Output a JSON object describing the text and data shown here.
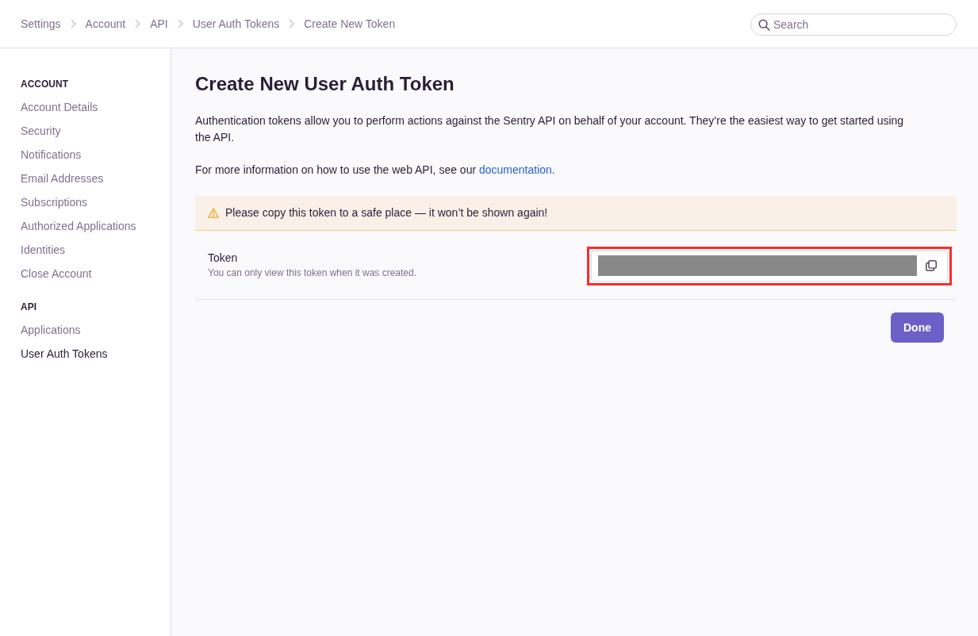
{
  "breadcrumbs": [
    {
      "label": "Settings"
    },
    {
      "label": "Account"
    },
    {
      "label": "API"
    },
    {
      "label": "User Auth Tokens"
    },
    {
      "label": "Create New Token"
    }
  ],
  "search": {
    "placeholder": "Search"
  },
  "sidebar": {
    "sections": [
      {
        "heading": "ACCOUNT",
        "items": [
          {
            "label": "Account Details",
            "selected": false
          },
          {
            "label": "Security",
            "selected": false
          },
          {
            "label": "Notifications",
            "selected": false
          },
          {
            "label": "Email Addresses",
            "selected": false
          },
          {
            "label": "Subscriptions",
            "selected": false
          },
          {
            "label": "Authorized Applications",
            "selected": false
          },
          {
            "label": "Identities",
            "selected": false
          },
          {
            "label": "Close Account",
            "selected": false
          }
        ]
      },
      {
        "heading": "API",
        "items": [
          {
            "label": "Applications",
            "selected": false
          },
          {
            "label": "User Auth Tokens",
            "selected": true
          }
        ]
      }
    ]
  },
  "page": {
    "title": "Create New User Auth Token",
    "description": "Authentication tokens allow you to perform actions against the Sentry API on behalf of your account. They’re the easiest way to get started using the API.",
    "docs_note": {
      "text_before": "For more information on how to use the web API, see our ",
      "link": "documentation",
      "text_after": "."
    }
  },
  "alert": {
    "kind": "warning",
    "text": "Please copy this token to a safe place — it won’t be shown again!"
  },
  "token_field": {
    "label": "Token",
    "help": "You can only view this token when it was created.",
    "redacted": true,
    "highlighted": true
  },
  "buttons": [
    {
      "label": "Done",
      "kind": "primary"
    }
  ]
}
